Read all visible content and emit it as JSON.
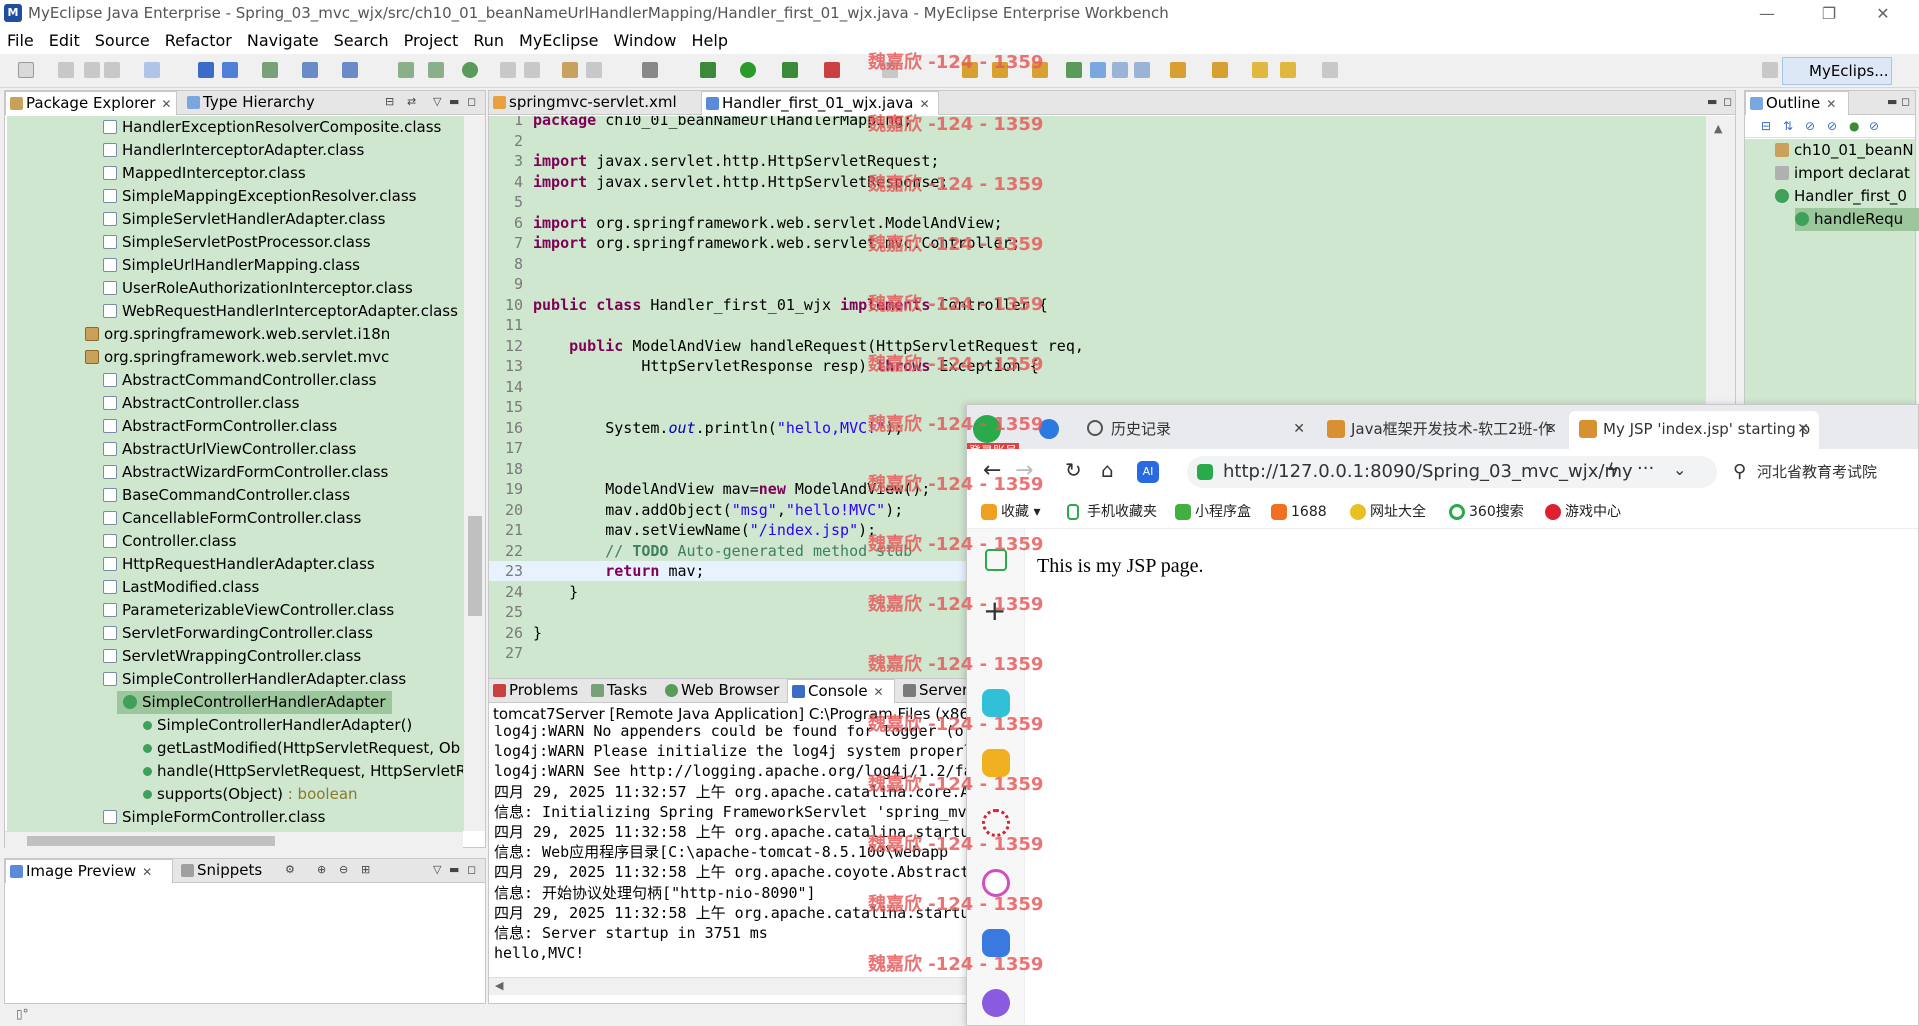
{
  "window": {
    "title": "MyEclipse Java Enterprise - Spring_03_mvc_wjx/src/ch10_01_beanNameUrlHandlerMapping/Handler_first_01_wjx.java - MyEclipse Enterprise Workbench",
    "minimize": "—",
    "restore": "❐",
    "close": "✕"
  },
  "menu": [
    "File",
    "Edit",
    "Source",
    "Refactor",
    "Navigate",
    "Search",
    "Project",
    "Run",
    "MyEclipse",
    "Window",
    "Help"
  ],
  "toolbar": {
    "perspective_label": "MyEclips..."
  },
  "package_explorer": {
    "tabs": [
      {
        "label": "Package Explorer"
      },
      {
        "label": "Type Hierarchy"
      }
    ],
    "items": [
      {
        "label": "HandlerExceptionResolverComposite.class",
        "kind": "class",
        "indent": 1
      },
      {
        "label": "HandlerInterceptorAdapter.class",
        "kind": "class",
        "indent": 1
      },
      {
        "label": "MappedInterceptor.class",
        "kind": "class",
        "indent": 1
      },
      {
        "label": "SimpleMappingExceptionResolver.class",
        "kind": "class",
        "indent": 1
      },
      {
        "label": "SimpleServletHandlerAdapter.class",
        "kind": "class",
        "indent": 1
      },
      {
        "label": "SimpleServletPostProcessor.class",
        "kind": "class",
        "indent": 1
      },
      {
        "label": "SimpleUrlHandlerMapping.class",
        "kind": "class",
        "indent": 1
      },
      {
        "label": "UserRoleAuthorizationInterceptor.class",
        "kind": "class",
        "indent": 1
      },
      {
        "label": "WebRequestHandlerInterceptorAdapter.class",
        "kind": "class",
        "indent": 1
      },
      {
        "label": "org.springframework.web.servlet.i18n",
        "kind": "package",
        "indent": 0
      },
      {
        "label": "org.springframework.web.servlet.mvc",
        "kind": "package",
        "indent": 0
      },
      {
        "label": "AbstractCommandController.class",
        "kind": "class",
        "indent": 1
      },
      {
        "label": "AbstractController.class",
        "kind": "class",
        "indent": 1
      },
      {
        "label": "AbstractFormController.class",
        "kind": "class",
        "indent": 1
      },
      {
        "label": "AbstractUrlViewController.class",
        "kind": "class",
        "indent": 1
      },
      {
        "label": "AbstractWizardFormController.class",
        "kind": "class",
        "indent": 1
      },
      {
        "label": "BaseCommandController.class",
        "kind": "class",
        "indent": 1
      },
      {
        "label": "CancellableFormController.class",
        "kind": "class",
        "indent": 1
      },
      {
        "label": "Controller.class",
        "kind": "class",
        "indent": 1
      },
      {
        "label": "HttpRequestHandlerAdapter.class",
        "kind": "class",
        "indent": 1
      },
      {
        "label": "LastModified.class",
        "kind": "class",
        "indent": 1
      },
      {
        "label": "ParameterizableViewController.class",
        "kind": "class",
        "indent": 1
      },
      {
        "label": "ServletForwardingController.class",
        "kind": "class",
        "indent": 1
      },
      {
        "label": "ServletWrappingController.class",
        "kind": "class",
        "indent": 1
      },
      {
        "label": "SimpleControllerHandlerAdapter.class",
        "kind": "class",
        "indent": 1
      },
      {
        "label": "SimpleControllerHandlerAdapter",
        "kind": "type",
        "indent": 2,
        "selected": true
      },
      {
        "label": "SimpleControllerHandlerAdapter()",
        "kind": "ctor",
        "indent": 3
      },
      {
        "label": "getLastModified(HttpServletRequest, Ob",
        "kind": "method",
        "indent": 3
      },
      {
        "label": "handle(HttpServletRequest, HttpServletR",
        "kind": "method",
        "indent": 3
      },
      {
        "label": "supports(Object)",
        "kind": "method",
        "indent": 3,
        "ret": " : boolean"
      },
      {
        "label": "SimpleFormController.class",
        "kind": "class",
        "indent": 1
      }
    ]
  },
  "image_preview": {
    "tabs": [
      {
        "label": "Image Preview"
      },
      {
        "label": "Snippets"
      }
    ]
  },
  "editor": {
    "tabs": [
      {
        "label": "springmvc-servlet.xml"
      },
      {
        "label": "Handler_first_01_wjx.java"
      }
    ],
    "lines": [
      {
        "n": "1",
        "html": "<span class=\"kw\">package</span> ch10_01_beanNameUrlHandlerMapping;"
      },
      {
        "n": "2",
        "html": ""
      },
      {
        "n": "3",
        "html": "<span class=\"kw\">import</span> javax.servlet.http.HttpServletRequest;"
      },
      {
        "n": "4",
        "html": "<span class=\"kw\">import</span> javax.servlet.http.HttpServletResponse;"
      },
      {
        "n": "5",
        "html": ""
      },
      {
        "n": "6",
        "html": "<span class=\"kw\">import</span> org.springframework.web.servlet.ModelAndView;"
      },
      {
        "n": "7",
        "html": "<span class=\"kw\">import</span> org.springframework.web.servlet.mvc.Controller;"
      },
      {
        "n": "8",
        "html": ""
      },
      {
        "n": "9",
        "html": ""
      },
      {
        "n": "10",
        "html": "<span class=\"kw\">public</span> <span class=\"kw\">class</span> Handler_first_01_wjx <span class=\"kw\">implements</span> Controller {"
      },
      {
        "n": "11",
        "html": ""
      },
      {
        "n": "12",
        "html": "    <span class=\"kw\">public</span> ModelAndView handleRequest(HttpServletRequest req,"
      },
      {
        "n": "13",
        "html": "            HttpServletResponse resp) <span class=\"kw\">throws</span> Exception {"
      },
      {
        "n": "14",
        "html": ""
      },
      {
        "n": "15",
        "html": ""
      },
      {
        "n": "16",
        "html": "        System.<span class=\"it\">out</span>.println(<span class=\"str\">\"hello,MVC!\"</span>);"
      },
      {
        "n": "17",
        "html": ""
      },
      {
        "n": "18",
        "html": ""
      },
      {
        "n": "19",
        "html": "        ModelAndView mav=<span class=\"kw\">new</span> ModelAndView();"
      },
      {
        "n": "20",
        "html": "        mav.addObject(<span class=\"str\">\"msg\"</span>,<span class=\"str\">\"hello!MVC\"</span>);"
      },
      {
        "n": "21",
        "html": "        mav.setViewName(<span class=\"str\">\"/index.jsp\"</span>);"
      },
      {
        "n": "22",
        "html": "        <span class=\"cm\">// <b>TODO</b> Auto-generated method stub</span>"
      },
      {
        "n": "23",
        "html": "        <span class=\"kw\">return</span> mav;",
        "current": true
      },
      {
        "n": "24",
        "html": "    }"
      },
      {
        "n": "25",
        "html": ""
      },
      {
        "n": "26",
        "html": "}"
      },
      {
        "n": "27",
        "html": ""
      }
    ]
  },
  "outline": {
    "tab": "Outline",
    "items": [
      {
        "label": "ch10_01_beanN"
      },
      {
        "label": "import declarat"
      },
      {
        "label": "Handler_first_0"
      },
      {
        "label": "handleRequ"
      }
    ]
  },
  "console": {
    "tabs": [
      {
        "label": "Problems"
      },
      {
        "label": "Tasks"
      },
      {
        "label": "Web Browser"
      },
      {
        "label": "Console"
      },
      {
        "label": "Servers"
      }
    ],
    "header": "tomcat7Server [Remote Java Application] C:\\Program Files (x86)\\",
    "lines": [
      {
        "text": "log4j:WARN No appenders could be found for logger (or",
        "red": false
      },
      {
        "text": "log4j:WARN Please initialize the log4j system properl",
        "red": false
      },
      {
        "text": "log4j:WARN See http://logging.apache.org/log4j/1.2/fa",
        "red": false
      },
      {
        "text": "四月 29, 2025 11:32:57 上午 org.apache.catalina.core.A",
        "red": false
      },
      {
        "text": "信息: Initializing Spring FrameworkServlet 'spring_mv",
        "red": false
      },
      {
        "text": "四月 29, 2025 11:32:58 上午 org.apache.catalina.startu",
        "red": false
      },
      {
        "text": "信息: Web应用程序目录[C:\\apache-tomcat-8.5.100\\webapp",
        "red": false
      },
      {
        "text": "四月 29, 2025 11:32:58 上午 org.apache.coyote.Abstract",
        "red": false
      },
      {
        "text": "信息: 开始协议处理句柄[\"http-nio-8090\"]",
        "red": false
      },
      {
        "text": "四月 29, 2025 11:32:58 上午 org.apache.catalina.startu",
        "red": false
      },
      {
        "text": "信息: Server startup in 3751 ms",
        "red": false
      },
      {
        "text": "hello,MVC!",
        "red": false
      }
    ]
  },
  "browser": {
    "badge": "登录账号",
    "tabs": [
      {
        "label": "历史记录"
      },
      {
        "label": "Java框架开发技术-软工2班-作"
      },
      {
        "label": "My JSP 'index.jsp' starting p"
      }
    ],
    "url": "http://127.0.0.1:8090/Spring_03_mvc_wjx/my",
    "search_placeholder": "河北省教育考试院",
    "bookmarks": [
      "收藏",
      "手机收藏夹",
      "小程序盒",
      "1688",
      "网址大全",
      "360搜索",
      "游戏中心"
    ],
    "page_text": "This is my JSP page."
  },
  "watermark": "魏嘉欣 -124 - 1359",
  "colors": {
    "editor_bg": "#cfe6cf",
    "keyword": "#7f0055",
    "string": "#2a00ff",
    "comment": "#3f7f5f",
    "watermark": "#e65a5a"
  }
}
